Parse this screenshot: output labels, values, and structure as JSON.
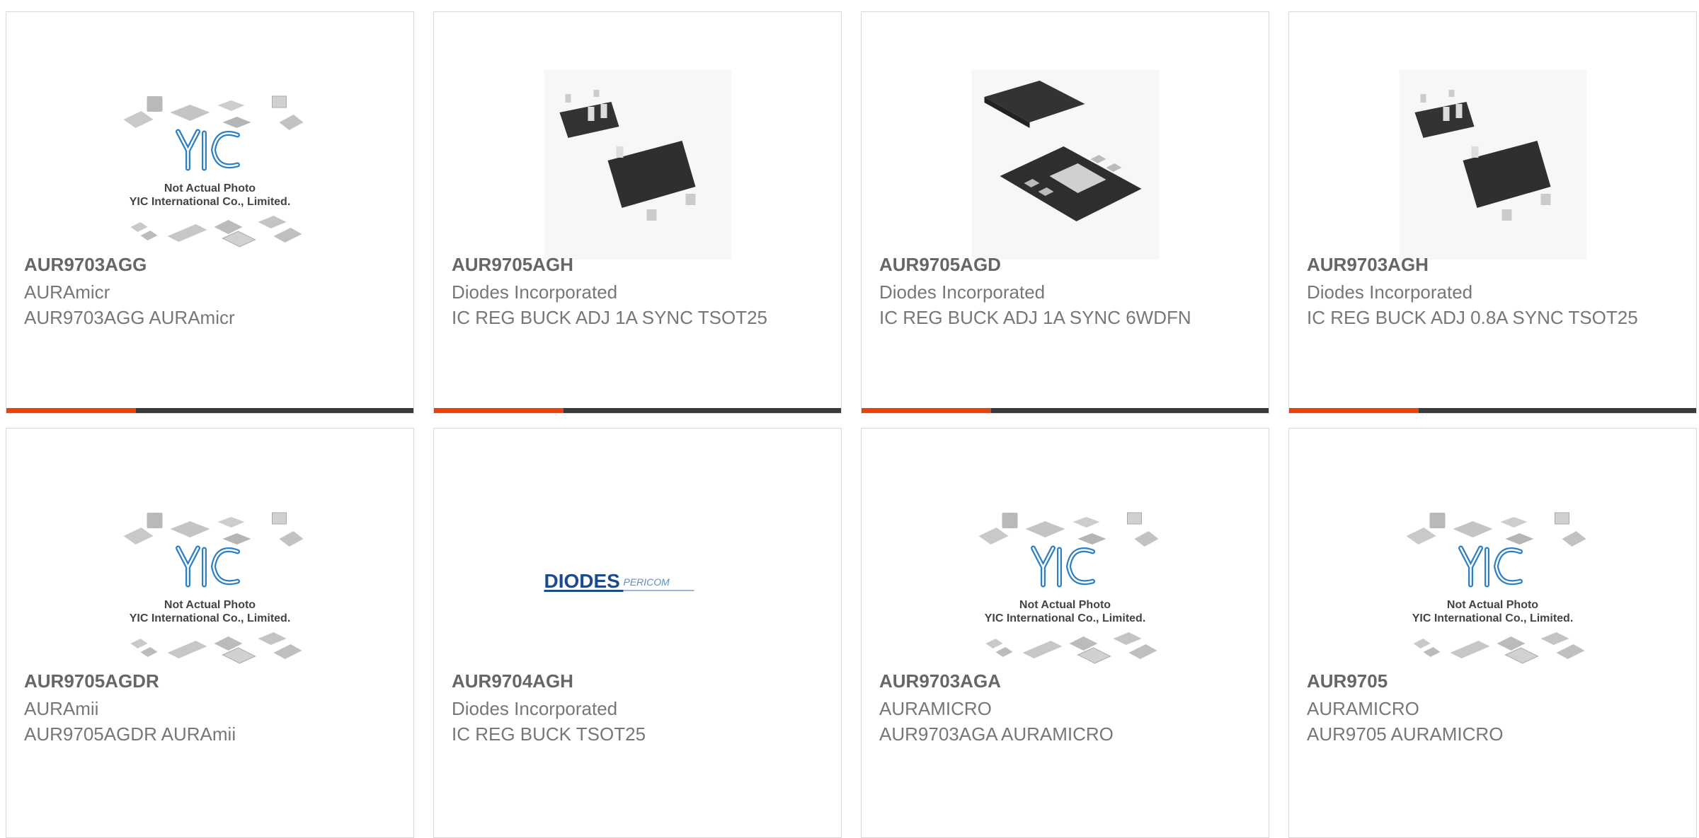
{
  "colors": {
    "accent": "#e8430f",
    "bar": "#3a3a3a",
    "text": "#777777",
    "part": "#666666",
    "yic_blue": "#2b7fc2",
    "diodes_blue": "#1d4a8c"
  },
  "products": [
    {
      "part": "AUR9703AGG",
      "maker": "AURAmicr",
      "desc": "AUR9703AGG AURAmicr",
      "image": "yic-placeholder",
      "placeholder": {
        "line1": "Not Actual Photo",
        "line2": "YIC International Co., Limited."
      }
    },
    {
      "part": "AUR9705AGH",
      "maker": "Diodes Incorporated",
      "desc": "IC REG BUCK ADJ 1A SYNC TSOT25",
      "image": "tsot25-chip"
    },
    {
      "part": "AUR9705AGD",
      "maker": "Diodes Incorporated",
      "desc": "IC REG BUCK ADJ 1A SYNC 6WDFN",
      "image": "wdfn-chip"
    },
    {
      "part": "AUR9703AGH",
      "maker": "Diodes Incorporated",
      "desc": "IC REG BUCK ADJ 0.8A SYNC TSOT25",
      "image": "tsot25-chip"
    },
    {
      "part": "AUR9705AGDR",
      "maker": "AURAmii",
      "desc": "AUR9705AGDR AURAmii",
      "image": "yic-placeholder",
      "placeholder": {
        "line1": "Not Actual Photo",
        "line2": "YIC International Co., Limited."
      }
    },
    {
      "part": "AUR9704AGH",
      "maker": "Diodes Incorporated",
      "desc": "IC REG BUCK TSOT25",
      "image": "diodes-pericom-logo",
      "logo": {
        "left": "DIODES",
        "right": "PERICOM"
      }
    },
    {
      "part": "AUR9703AGA",
      "maker": "AURAMICRO",
      "desc": "AUR9703AGA AURAMICRO",
      "image": "yic-placeholder",
      "placeholder": {
        "line1": "Not Actual Photo",
        "line2": "YIC International Co., Limited."
      }
    },
    {
      "part": "AUR9705",
      "maker": "AURAMICRO",
      "desc": "AUR9705 AURAMICRO",
      "image": "yic-placeholder",
      "placeholder": {
        "line1": "Not Actual Photo",
        "line2": "YIC International Co., Limited."
      }
    }
  ]
}
